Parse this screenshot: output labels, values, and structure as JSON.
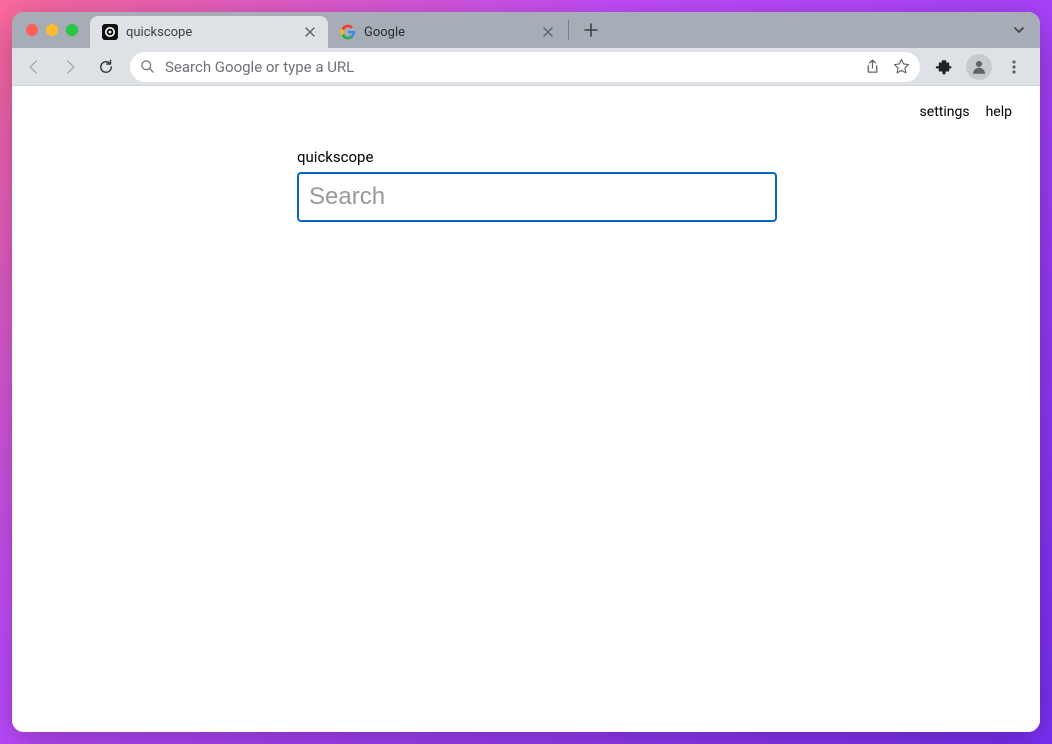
{
  "browser": {
    "tabs": [
      {
        "title": "quickscope",
        "active": true
      },
      {
        "title": "Google",
        "active": false
      }
    ],
    "omnibox_placeholder": "Search Google or type a URL"
  },
  "page": {
    "top_links": {
      "settings": "settings",
      "help": "help"
    },
    "app_title": "quickscope",
    "search": {
      "placeholder": "Search",
      "value": ""
    }
  }
}
